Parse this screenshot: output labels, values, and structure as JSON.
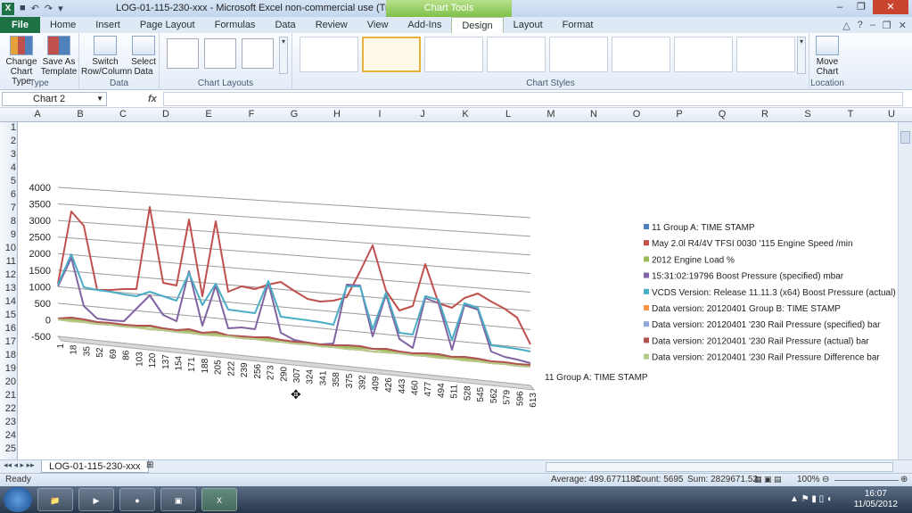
{
  "window": {
    "title": "LOG-01-115-230-xxx - Microsoft Excel non-commercial use (Trial)",
    "chart_tools_header": "Chart Tools"
  },
  "ribbon_tabs": [
    "File",
    "Home",
    "Insert",
    "Page Layout",
    "Formulas",
    "Data",
    "Review",
    "View",
    "Add-Ins",
    "Design",
    "Layout",
    "Format"
  ],
  "ribbon": {
    "type_group": {
      "label": "Type",
      "change_chart_type": "Change Chart Type",
      "save_as_template": "Save As Template"
    },
    "data_group": {
      "label": "Data",
      "switch_row_column": "Switch Row/Column",
      "select_data": "Select Data"
    },
    "layouts_group": {
      "label": "Chart Layouts"
    },
    "styles_group": {
      "label": "Chart Styles"
    },
    "location_group": {
      "label": "Location",
      "move_chart": "Move Chart"
    }
  },
  "formula_bar": {
    "name_box": "Chart 2",
    "fx": "fx",
    "value": ""
  },
  "columns": [
    "A",
    "B",
    "C",
    "D",
    "E",
    "F",
    "G",
    "H",
    "I",
    "J",
    "K",
    "L",
    "M",
    "N",
    "O",
    "P",
    "Q",
    "R",
    "S",
    "T",
    "U"
  ],
  "rows": [
    "1",
    "2",
    "3",
    "4",
    "5",
    "6",
    "7",
    "8",
    "9",
    "10",
    "11",
    "12",
    "13",
    "14",
    "15",
    "16",
    "17",
    "18",
    "19",
    "20",
    "21",
    "22",
    "23",
    "24",
    "25"
  ],
  "sheet_tab": "LOG-01-115-230-xxx",
  "status": {
    "ready": "Ready",
    "average": "Average: 499.6771181",
    "count": "Count: 5695",
    "sum": "Sum: 2829671.52",
    "zoom": "100%"
  },
  "clock": {
    "time": "16:07",
    "date": "11/05/2012"
  },
  "chart_data": {
    "type": "line",
    "title": "",
    "xlabel": "11 Group A: TIME STAMP",
    "ylabel": "",
    "ylim": [
      0,
      4000
    ],
    "y_ticks": [
      "4000",
      "3500",
      "3000",
      "2500",
      "2000",
      "1500",
      "1000",
      "500",
      "0",
      "-500"
    ],
    "x_ticks": [
      "1",
      "18",
      "35",
      "52",
      "69",
      "86",
      "103",
      "120",
      "137",
      "154",
      "171",
      "188",
      "205",
      "222",
      "239",
      "256",
      "273",
      "290",
      "307",
      "324",
      "341",
      "358",
      "375",
      "392",
      "409",
      "426",
      "443",
      "460",
      "477",
      "494",
      "511",
      "528",
      "545",
      "562",
      "579",
      "596",
      "613"
    ],
    "legend_position": "right",
    "series": [
      {
        "name": "11 Group A: TIME STAMP",
        "color": "#4f81bd",
        "values": [
          0,
          0,
          0,
          0,
          0,
          0,
          0,
          0,
          0,
          0,
          0,
          0,
          0,
          0,
          0,
          0,
          0,
          0,
          0,
          0,
          0,
          0,
          0,
          0,
          0,
          0,
          0,
          0,
          0,
          0,
          0,
          0,
          0,
          0,
          0,
          0,
          0
        ]
      },
      {
        "name": "May 2.0l R4/4V TFSI     0030 '115 Engine Speed  /min",
        "color": "#c0504d",
        "values": [
          1100,
          3300,
          2900,
          1000,
          1050,
          1100,
          1150,
          3600,
          1400,
          1350,
          3300,
          1100,
          3300,
          1300,
          1500,
          1450,
          1600,
          1700,
          1500,
          1300,
          1250,
          1300,
          1450,
          2200,
          2950,
          1700,
          1200,
          1350,
          2550,
          1500,
          1400,
          1700,
          1850,
          1650,
          1500,
          1300,
          600
        ]
      },
      {
        "name": "2012 Engine Load  %",
        "color": "#9bbb59",
        "values": [
          40,
          60,
          50,
          30,
          30,
          40,
          40,
          60,
          40,
          40,
          60,
          30,
          60,
          40,
          50,
          40,
          50,
          60,
          50,
          40,
          40,
          40,
          50,
          60,
          70,
          50,
          40,
          40,
          60,
          50,
          40,
          50,
          60,
          50,
          40,
          40,
          20
        ]
      },
      {
        "name": "15:31:02:19796 Boost Pressure (specified)  mbar",
        "color": "#8064a2",
        "values": [
          1000,
          1900,
          500,
          150,
          150,
          150,
          550,
          1000,
          450,
          300,
          1800,
          250,
          1450,
          250,
          300,
          300,
          1650,
          250,
          100,
          50,
          50,
          100,
          1800,
          1800,
          400,
          1600,
          400,
          200,
          1600,
          1500,
          250,
          1500,
          1400,
          300,
          200,
          150,
          100
        ]
      },
      {
        "name": "VCDS Version:  Release 11.11.3 (x64) Boost Pressure (actual)  mbar",
        "color": "#4bacc6",
        "values": [
          1050,
          2000,
          1050,
          1000,
          980,
          960,
          940,
          1100,
          1000,
          900,
          1750,
          850,
          1500,
          780,
          760,
          740,
          1700,
          720,
          700,
          680,
          660,
          640,
          1750,
          1780,
          600,
          1650,
          580,
          560,
          1650,
          1580,
          520,
          1550,
          1450,
          480,
          460,
          440,
          400
        ]
      },
      {
        "name": "Data version:  20120401  Group B: TIME STAMP",
        "color": "#f79646",
        "values": [
          0,
          0,
          0,
          0,
          0,
          0,
          0,
          0,
          0,
          0,
          0,
          0,
          0,
          0,
          0,
          0,
          0,
          0,
          0,
          0,
          0,
          0,
          0,
          0,
          0,
          0,
          0,
          0,
          0,
          0,
          0,
          0,
          0,
          0,
          0,
          0,
          0
        ]
      },
      {
        "name": "Data version:  20120401  '230 Rail Pressure (specified)  bar",
        "color": "#94a8d6",
        "values": [
          50,
          100,
          80,
          50,
          50,
          50,
          60,
          100,
          60,
          50,
          100,
          50,
          100,
          50,
          50,
          50,
          90,
          50,
          50,
          50,
          50,
          50,
          100,
          100,
          60,
          90,
          60,
          50,
          90,
          90,
          50,
          90,
          80,
          50,
          50,
          50,
          40
        ]
      },
      {
        "name": "Data version:  20120401  '230 Rail Pressure (actual)  bar",
        "color": "#b2534f",
        "values": [
          50,
          100,
          80,
          50,
          50,
          50,
          60,
          100,
          60,
          50,
          100,
          50,
          100,
          50,
          50,
          50,
          90,
          50,
          50,
          50,
          50,
          50,
          100,
          100,
          60,
          90,
          60,
          50,
          90,
          90,
          50,
          90,
          80,
          50,
          50,
          50,
          40
        ]
      },
      {
        "name": "Data version:  20120401  '230 Rail Pressure Difference  bar",
        "color": "#b4cb8a",
        "values": [
          0,
          0,
          0,
          0,
          0,
          0,
          0,
          0,
          0,
          0,
          0,
          0,
          0,
          0,
          0,
          0,
          0,
          0,
          0,
          0,
          0,
          0,
          0,
          0,
          0,
          0,
          0,
          0,
          0,
          0,
          0,
          0,
          0,
          0,
          0,
          0,
          0
        ]
      }
    ]
  }
}
